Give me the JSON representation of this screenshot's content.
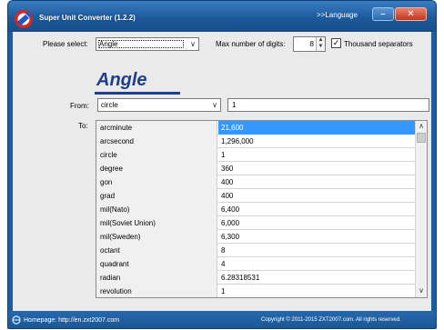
{
  "window": {
    "title": "Super Unit Converter (1.2.2)",
    "language_link": ">>Language",
    "minimize_glyph": "–",
    "close_glyph": "✕"
  },
  "toolbar": {
    "select_label": "Please select:",
    "select_value": "Angle",
    "max_digits_label": "Max number of digits:",
    "max_digits_value": "8",
    "thousand_sep_label": "Thousand separators",
    "thousand_sep_checked": true
  },
  "category_heading": "Angle",
  "from": {
    "label": "From:",
    "unit": "circle",
    "value": "1"
  },
  "to_label": "To:",
  "results": [
    {
      "unit": "arcminute",
      "value": "21,600"
    },
    {
      "unit": "arcsecond",
      "value": "1,296,000"
    },
    {
      "unit": "circle",
      "value": "1"
    },
    {
      "unit": "degree",
      "value": "360"
    },
    {
      "unit": "gon",
      "value": "400"
    },
    {
      "unit": "grad",
      "value": "400"
    },
    {
      "unit": "mil(Nato)",
      "value": "6,400"
    },
    {
      "unit": "mil(Soviet Union)",
      "value": "6,000"
    },
    {
      "unit": "mil(Sweden)",
      "value": "6,300"
    },
    {
      "unit": "octant",
      "value": "8"
    },
    {
      "unit": "quadrant",
      "value": "4"
    },
    {
      "unit": "radian",
      "value": "6.28318531"
    },
    {
      "unit": "revolution",
      "value": "1"
    }
  ],
  "selected_result_index": 0,
  "status": {
    "homepage": "Homepage: http://en.zxt2007.com",
    "copyright": "Copyright © 2011-2015 ZXT2007.com. All rights reserved."
  },
  "colors": {
    "titlebar": "#1c5a9b",
    "heading": "#1e3f8f",
    "selection": "#3399ff",
    "close_button": "#c2371e"
  },
  "icons": {
    "app": "app-logo-icon",
    "dropdown": "chevron-down-icon",
    "spin": "spin-arrows-icon",
    "check": "checkmark-icon",
    "homepage": "ie-globe-icon"
  }
}
